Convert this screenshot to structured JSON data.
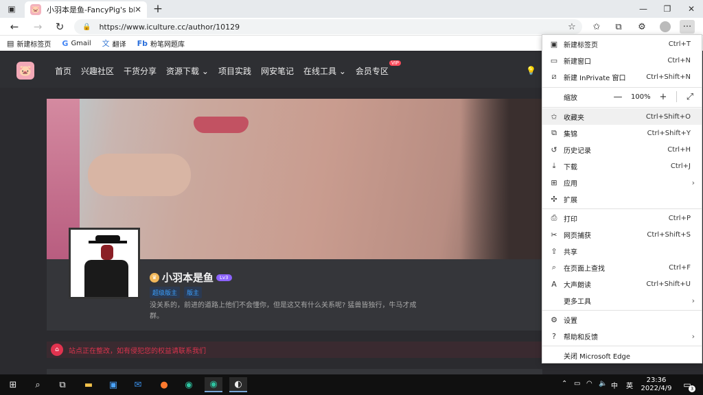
{
  "browser": {
    "tab_title": "小羽本是鱼-FancyPig's blog",
    "url": "https://www.iculture.cc/author/10129",
    "bookmarks": [
      {
        "label": "新建标签页",
        "icon": "page-icon"
      },
      {
        "label": "Gmail",
        "icon": "google-icon"
      },
      {
        "label": "翻译",
        "icon": "translate-icon"
      },
      {
        "label": "粉笔网题库",
        "icon": "fb-icon"
      }
    ]
  },
  "site": {
    "nav": [
      "首页",
      "兴趣社区",
      "干货分享",
      "资源下载",
      "项目实践",
      "网安笔记",
      "在线工具",
      "会员专区"
    ],
    "vip_badge": "VIP"
  },
  "profile": {
    "name": "小羽本是鱼",
    "level": "Lv3",
    "badges": [
      "超级版主",
      "版主"
    ],
    "bio": "没关系的，前进的道路上他们不会懂你，但是这又有什么关系呢? 猛兽皆独行，牛马才成群。"
  },
  "notice": {
    "text": "站点正在整改，如有侵犯您的权益请联系我们"
  },
  "edge_menu": {
    "new_tab": {
      "label": "新建标签页",
      "shortcut": "Ctrl+T"
    },
    "new_window": {
      "label": "新建窗口",
      "shortcut": "Ctrl+N"
    },
    "new_inprivate": {
      "label": "新建 InPrivate 窗口",
      "shortcut": "Ctrl+Shift+N"
    },
    "zoom": {
      "label": "缩放",
      "value": "100%",
      "minus": "—",
      "plus": "+"
    },
    "favorites": {
      "label": "收藏夹",
      "shortcut": "Ctrl+Shift+O"
    },
    "collections": {
      "label": "集锦",
      "shortcut": "Ctrl+Shift+Y"
    },
    "history": {
      "label": "历史记录",
      "shortcut": "Ctrl+H"
    },
    "downloads": {
      "label": "下载",
      "shortcut": "Ctrl+J"
    },
    "apps": {
      "label": "应用"
    },
    "extensions": {
      "label": "扩展"
    },
    "print": {
      "label": "打印",
      "shortcut": "Ctrl+P"
    },
    "web_capture": {
      "label": "网页捕获",
      "shortcut": "Ctrl+Shift+S"
    },
    "share": {
      "label": "共享"
    },
    "find": {
      "label": "在页面上查找",
      "shortcut": "Ctrl+F"
    },
    "read_aloud": {
      "label": "大声朗读",
      "shortcut": "Ctrl+Shift+U"
    },
    "more_tools": {
      "label": "更多工具"
    },
    "settings": {
      "label": "设置"
    },
    "help": {
      "label": "帮助和反馈"
    },
    "close": {
      "label": "关闭 Microsoft Edge"
    }
  },
  "taskbar": {
    "ime": "中",
    "tray_label": "英",
    "time": "23:36",
    "date": "2022/4/9",
    "notifications": "3"
  }
}
